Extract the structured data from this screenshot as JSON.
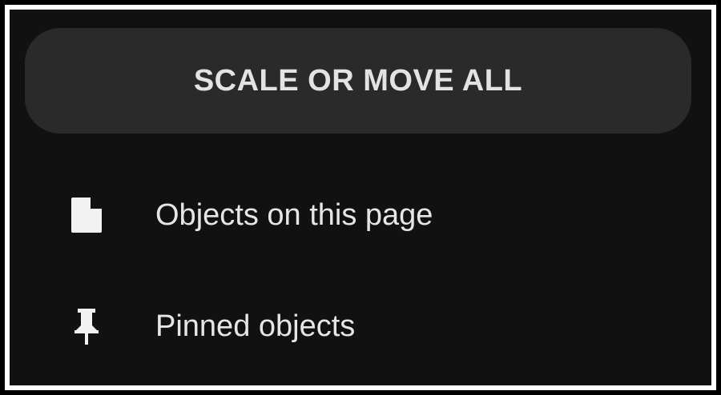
{
  "scale_button": {
    "label": "SCALE OR MOVE ALL"
  },
  "menu": {
    "items": [
      {
        "label": "Objects on this page",
        "icon": "file-icon"
      },
      {
        "label": "Pinned objects",
        "icon": "pin-icon"
      }
    ]
  }
}
